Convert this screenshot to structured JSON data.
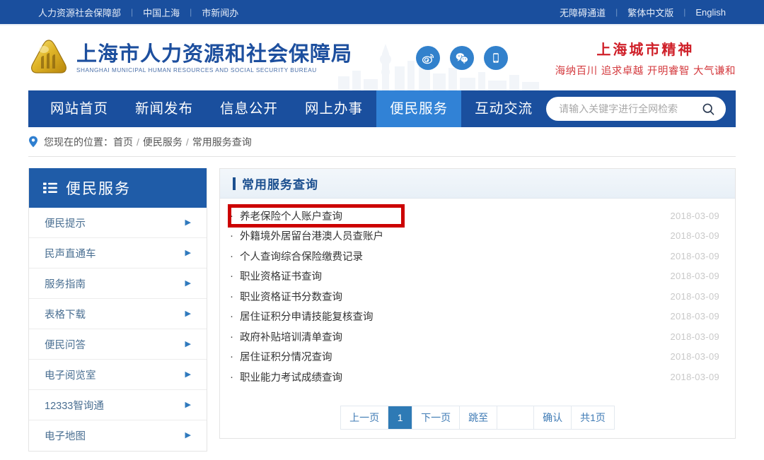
{
  "topbar": {
    "left_links": [
      "人力资源社会保障部",
      "中国上海",
      "市新闻办"
    ],
    "right_links": [
      "无障碍通道",
      "繁体中文版",
      "English"
    ],
    "separator": "|",
    "background": "#1a4f9e"
  },
  "masthead": {
    "logo_cn": "上海市人力资源和社会保障局",
    "logo_en": "SHANGHAI MUNICIPAL HUMAN RESOURCES AND SOCIAL SECURITY BUREAU",
    "social_icons": [
      "weibo-icon",
      "wechat-icon",
      "mobile-icon"
    ],
    "spirit_title": "上海城市精神",
    "spirit_subtitle": "海纳百川 追求卓越 开明睿智 大气谦和",
    "spirit_color": "#cf1f28",
    "logo_color": "#1d4f9e"
  },
  "nav": {
    "items": [
      {
        "label": "网站首页",
        "active": false
      },
      {
        "label": "新闻发布",
        "active": false
      },
      {
        "label": "信息公开",
        "active": false
      },
      {
        "label": "网上办事",
        "active": false
      },
      {
        "label": "便民服务",
        "active": true
      },
      {
        "label": "互动交流",
        "active": false
      }
    ],
    "active_color": "#3182d6",
    "background": "#1a4f9e"
  },
  "search": {
    "placeholder": "请输入关键字进行全网检索",
    "value": "",
    "icon": "search-icon"
  },
  "breadcrumb": {
    "icon": "location-pin-icon",
    "prefix": "您现在的位置：",
    "items": [
      "首页",
      "便民服务",
      "常用服务查询"
    ],
    "separator": "/"
  },
  "sidebar": {
    "icon": "list-icon",
    "title": "便民服务",
    "header_background": "#1f5ca8",
    "items": [
      {
        "label": "便民提示",
        "arrow": "chevron-right-icon"
      },
      {
        "label": "民声直通车",
        "arrow": "chevron-right-icon"
      },
      {
        "label": "服务指南",
        "arrow": "chevron-right-icon"
      },
      {
        "label": "表格下载",
        "arrow": "chevron-right-icon"
      },
      {
        "label": "便民问答",
        "arrow": "chevron-right-icon"
      },
      {
        "label": "电子阅览室",
        "arrow": "chevron-right-icon"
      },
      {
        "label": "12333智询通",
        "arrow": "chevron-right-icon"
      },
      {
        "label": "电子地图",
        "arrow": "chevron-right-icon"
      }
    ]
  },
  "panel": {
    "title": "常用服务查询",
    "title_color": "#1b4f8f",
    "rows": [
      {
        "label": "养老保险个人账户查询",
        "date": "2018-03-09",
        "highlighted": true
      },
      {
        "label": "外籍境外居留台港澳人员查账户",
        "date": "2018-03-09",
        "highlighted": false
      },
      {
        "label": "个人查询综合保险缴费记录",
        "date": "2018-03-09",
        "highlighted": false
      },
      {
        "label": "职业资格证书查询",
        "date": "2018-03-09",
        "highlighted": false
      },
      {
        "label": "职业资格证书分数查询",
        "date": "2018-03-09",
        "highlighted": false
      },
      {
        "label": "居住证积分申请技能复核查询",
        "date": "2018-03-09",
        "highlighted": false
      },
      {
        "label": "政府补贴培训清单查询",
        "date": "2018-03-09",
        "highlighted": false
      },
      {
        "label": "居住证积分情况查询",
        "date": "2018-03-09",
        "highlighted": false
      },
      {
        "label": "职业能力考试成绩查询",
        "date": "2018-03-09",
        "highlighted": false
      }
    ],
    "bullet": "·",
    "annotation_color": "#cc0000"
  },
  "pagination": {
    "prev_label": "上一页",
    "current_page": "1",
    "next_label": "下一页",
    "jump_label": "跳至",
    "jump_value": "",
    "confirm_label": "确认",
    "total_label": "共1页",
    "active_background": "#2e7ab5"
  }
}
